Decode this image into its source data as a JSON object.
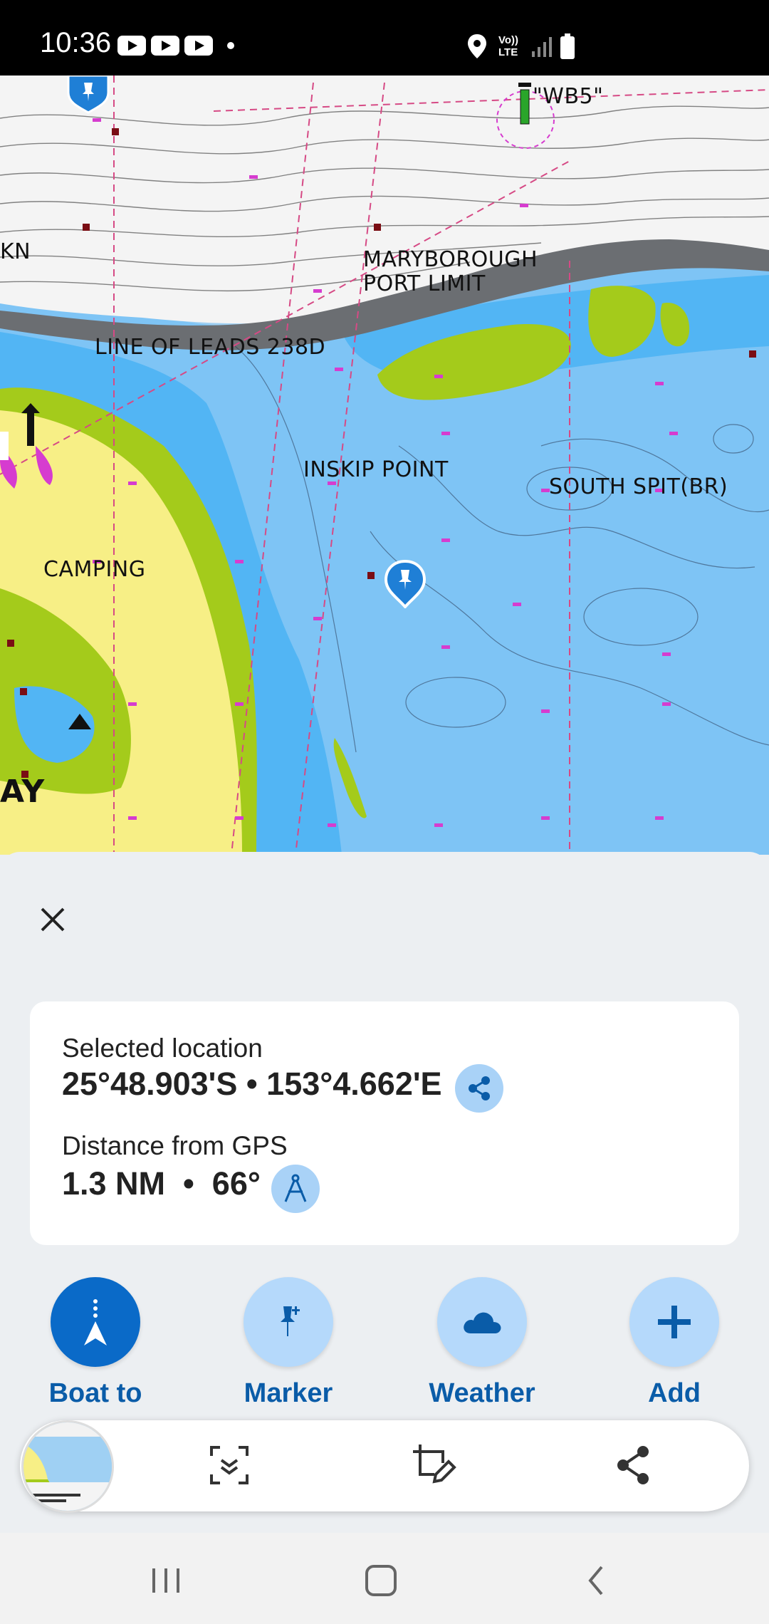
{
  "status_bar": {
    "time": "10:36",
    "notification_icons": [
      "youtube-icon",
      "youtube-icon",
      "youtube-icon"
    ],
    "right_icons": [
      "location-icon",
      "volte-lte-icon",
      "signal-icon",
      "battery-icon"
    ],
    "volte_label": "Vo)) LTE"
  },
  "map": {
    "labels": {
      "wb5": "\"WB5\"",
      "kn": "KN",
      "maryborough": "MARYBOROUGH\nPORT LIMIT",
      "line_of_leads": "LINE OF LEADS 238D",
      "inskip_point": "INSKIP POINT",
      "south_spit": "SOUTH SPIT(BR)",
      "camping": "CAMPING",
      "ay": "AY"
    },
    "colors": {
      "deep_water": "#9fd0f3",
      "shallow_water": "#52b5f4",
      "land": "#f7ef86",
      "intertidal": "#a4cb1b",
      "marker": "#1f7fd6"
    }
  },
  "sheet": {
    "selected_location_label": "Selected location",
    "coordinates": "25°48.903'S • 153°4.662'E",
    "distance_label": "Distance from GPS",
    "distance_value": "1.3 NM  •  66°",
    "actions": [
      {
        "label": "Boat to",
        "icon": "boat-to-icon"
      },
      {
        "label": "Marker",
        "icon": "marker-pin-icon"
      },
      {
        "label": "Weather",
        "icon": "cloud-icon"
      },
      {
        "label": "Add",
        "icon": "plus-icon"
      }
    ]
  },
  "screenshot_toolbar": {
    "icons": [
      "screenshot-thumbnail",
      "scroll-capture-icon",
      "crop-edit-icon",
      "share-icon"
    ]
  },
  "nav_bar": {
    "icons": [
      "recent-apps-icon",
      "home-icon",
      "back-icon"
    ]
  }
}
